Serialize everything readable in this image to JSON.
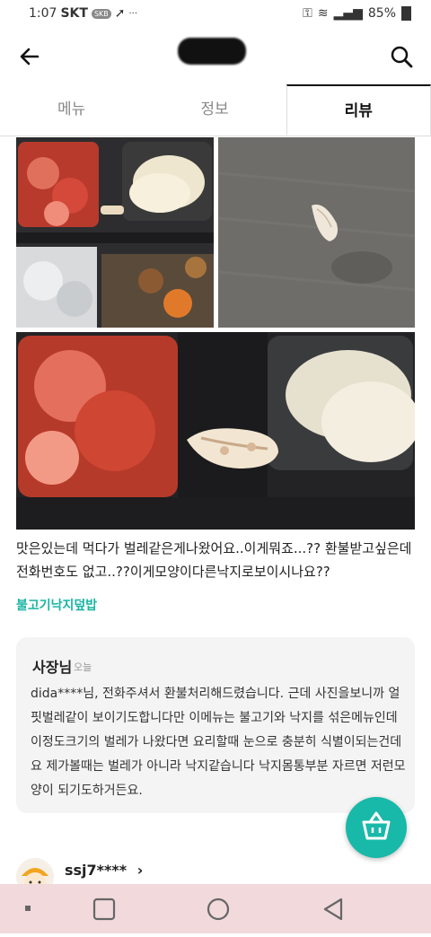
{
  "status_bar": {
    "time": "1:07",
    "carrier": "SKT",
    "badge": "SKB",
    "battery": "85%"
  },
  "tabs": [
    {
      "label": "메뉴",
      "active": false
    },
    {
      "label": "정보",
      "active": false
    },
    {
      "label": "리뷰",
      "active": true
    }
  ],
  "review": {
    "text": "맛은있는데 먹다가 벌레같은게나왔어요..이게뭐죠...?? 환불받고싶은데 전화번호도 없고..??이게모양이다른낙지로보이시나요??",
    "menu_tag": "불고기낙지덮밥",
    "reply": {
      "author": "사장님",
      "date": "오늘",
      "text": "dida****님, 전화주셔서 환불처리해드렸습니다. 근데 사진을보니까 얼핏벌레같이 보이기도합니다만 이메뉴는 불고기와 낙지를 섞은메뉴인데 이정도크기의 벌레가 나왔다면 요리할때 눈으로 충분히 식별이되는건데요 제가볼때는 벌레가 아니라 낙지같습니다 낙지몸통부분 자르면 저런모양이 되기도하거든요."
    }
  },
  "next_review": {
    "username": "ssj7****",
    "chevron": "›"
  },
  "icons": {
    "back": "arrow-left-icon",
    "search": "search-icon",
    "cart": "basket-icon"
  },
  "colors": {
    "accent": "#18b9a8",
    "menu_tag": "#1ab4a4",
    "navbar": "#f1d9dc"
  }
}
